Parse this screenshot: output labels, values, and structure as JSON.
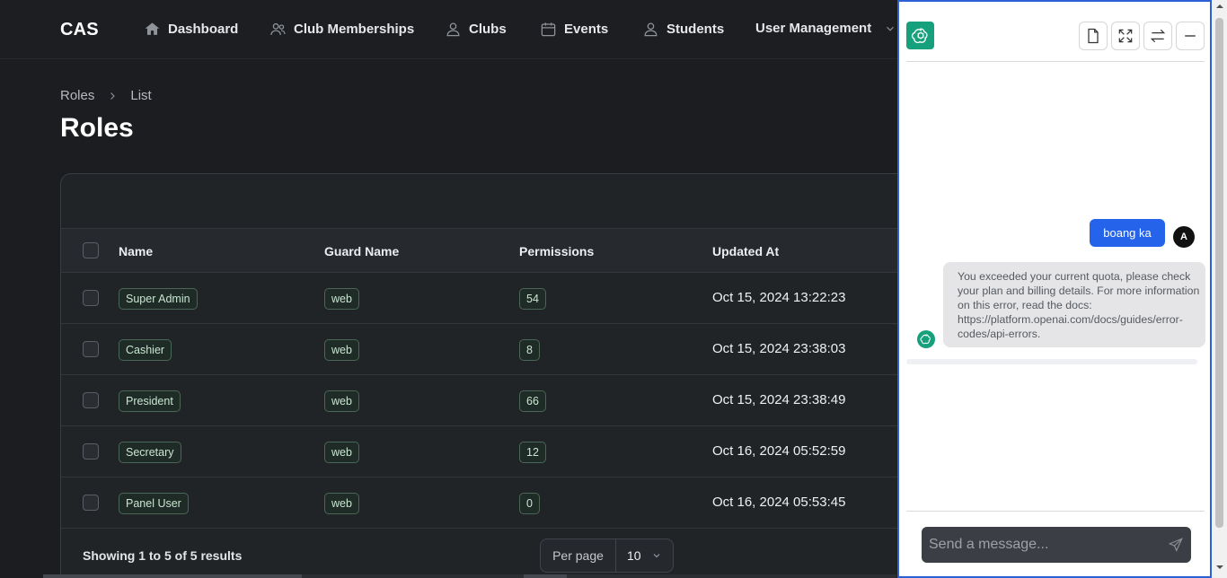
{
  "nav": {
    "brand": "CAS",
    "items": [
      {
        "label": "Dashboard",
        "icon": "home-icon"
      },
      {
        "label": "Club Memberships",
        "icon": "users-icon"
      },
      {
        "label": "Clubs",
        "icon": "user-icon"
      },
      {
        "label": "Events",
        "icon": "calendar-icon"
      },
      {
        "label": "Students",
        "icon": "user-icon"
      },
      {
        "label": "User Management",
        "icon": "chevron-down-icon"
      }
    ]
  },
  "breadcrumb": {
    "items": [
      "Roles",
      "List"
    ]
  },
  "page_title": "Roles",
  "table": {
    "columns": [
      "Name",
      "Guard Name",
      "Permissions",
      "Updated At"
    ],
    "rows": [
      {
        "name": "Super Admin",
        "guard": "web",
        "permissions": "54",
        "updated": "Oct 15, 2024 13:22:23"
      },
      {
        "name": "Cashier",
        "guard": "web",
        "permissions": "8",
        "updated": "Oct 15, 2024 23:38:03"
      },
      {
        "name": "President",
        "guard": "web",
        "permissions": "66",
        "updated": "Oct 15, 2024 23:38:49"
      },
      {
        "name": "Secretary",
        "guard": "web",
        "permissions": "12",
        "updated": "Oct 16, 2024 05:52:59"
      },
      {
        "name": "Panel User",
        "guard": "web",
        "permissions": "0",
        "updated": "Oct 16, 2024 05:53:45"
      }
    ],
    "showing": "Showing 1 to 5 of 5 results",
    "per_page_label": "Per page",
    "per_page_value": "10"
  },
  "chat": {
    "user_message": "boang ka",
    "user_avatar": "A",
    "bot_message": "You exceeded your current quota, please check your plan and billing details. For more information on this error, read the docs: https://platform.openai.com/docs/guides/error-codes/api-errors.",
    "input_placeholder": "Send a message...",
    "accent_color": "#2563eb",
    "logo_color": "#17a07c"
  }
}
